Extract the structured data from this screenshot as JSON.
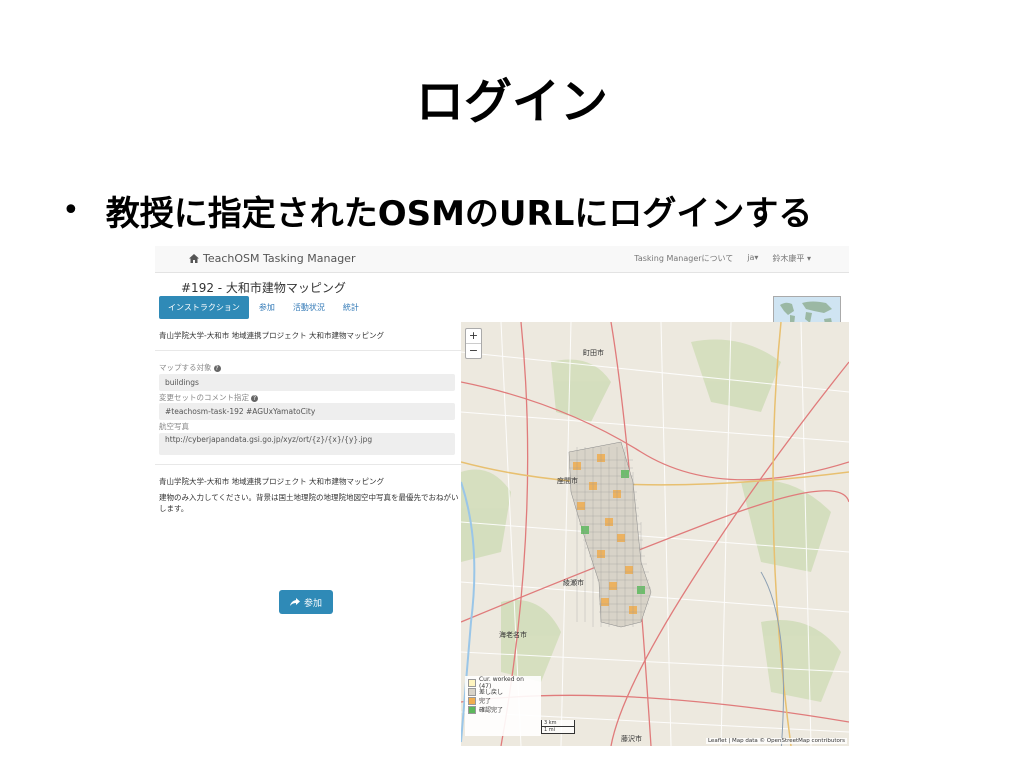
{
  "slide": {
    "title": "ログイン",
    "bullet": "教授に指定されたOSMのURLにログインする"
  },
  "navbar": {
    "brand": "TeachOSM Tasking Manager",
    "about": "Tasking Managerについて",
    "language": "ja▾",
    "user": "鈴木康平 ▾"
  },
  "project": {
    "title": "#192 - 大和市建物マッピング"
  },
  "tabs": [
    "インストラクション",
    "参加",
    "活動状況",
    "統計"
  ],
  "instructions": {
    "heading": "青山学院大学-大和市 地域連携プロジェクト 大和市建物マッピング",
    "map_target_label": "マップする対象",
    "map_target_value": "buildings",
    "changeset_label": "変更セットのコメント指定",
    "changeset_value": "#teachosm-task-192 #AGUxYamatoCity",
    "imagery_label": "航空写真",
    "imagery_value": "http://cyberjapandata.gsi.go.jp/xyz/ort/{z}/{x}/{y}.jpg",
    "desc_heading": "青山学院大学-大和市 地域連携プロジェクト 大和市建物マッピング",
    "desc_body": "建物のみ入力してください。背景は国土地理院の地理院地図空中写真を最優先でおねがいします。",
    "join_button": "参加"
  },
  "map": {
    "zoom_in": "+",
    "zoom_out": "−",
    "place_labels": [
      "町田市",
      "座間市",
      "綾瀬市",
      "海老名市",
      "藤沢市"
    ],
    "legend": [
      {
        "label": "Cur. worked on (47)",
        "color": "#fff5c0"
      },
      {
        "label": "差し戻し",
        "color": "#d9534f"
      },
      {
        "label": "完了",
        "color": "#f0ad4e"
      },
      {
        "label": "確認完了",
        "color": "#5cb85c"
      }
    ],
    "scale_km": "3 km",
    "scale_mi": "1 mi",
    "attribution": "Leaflet | Map data © OpenStreetMap contributors"
  }
}
